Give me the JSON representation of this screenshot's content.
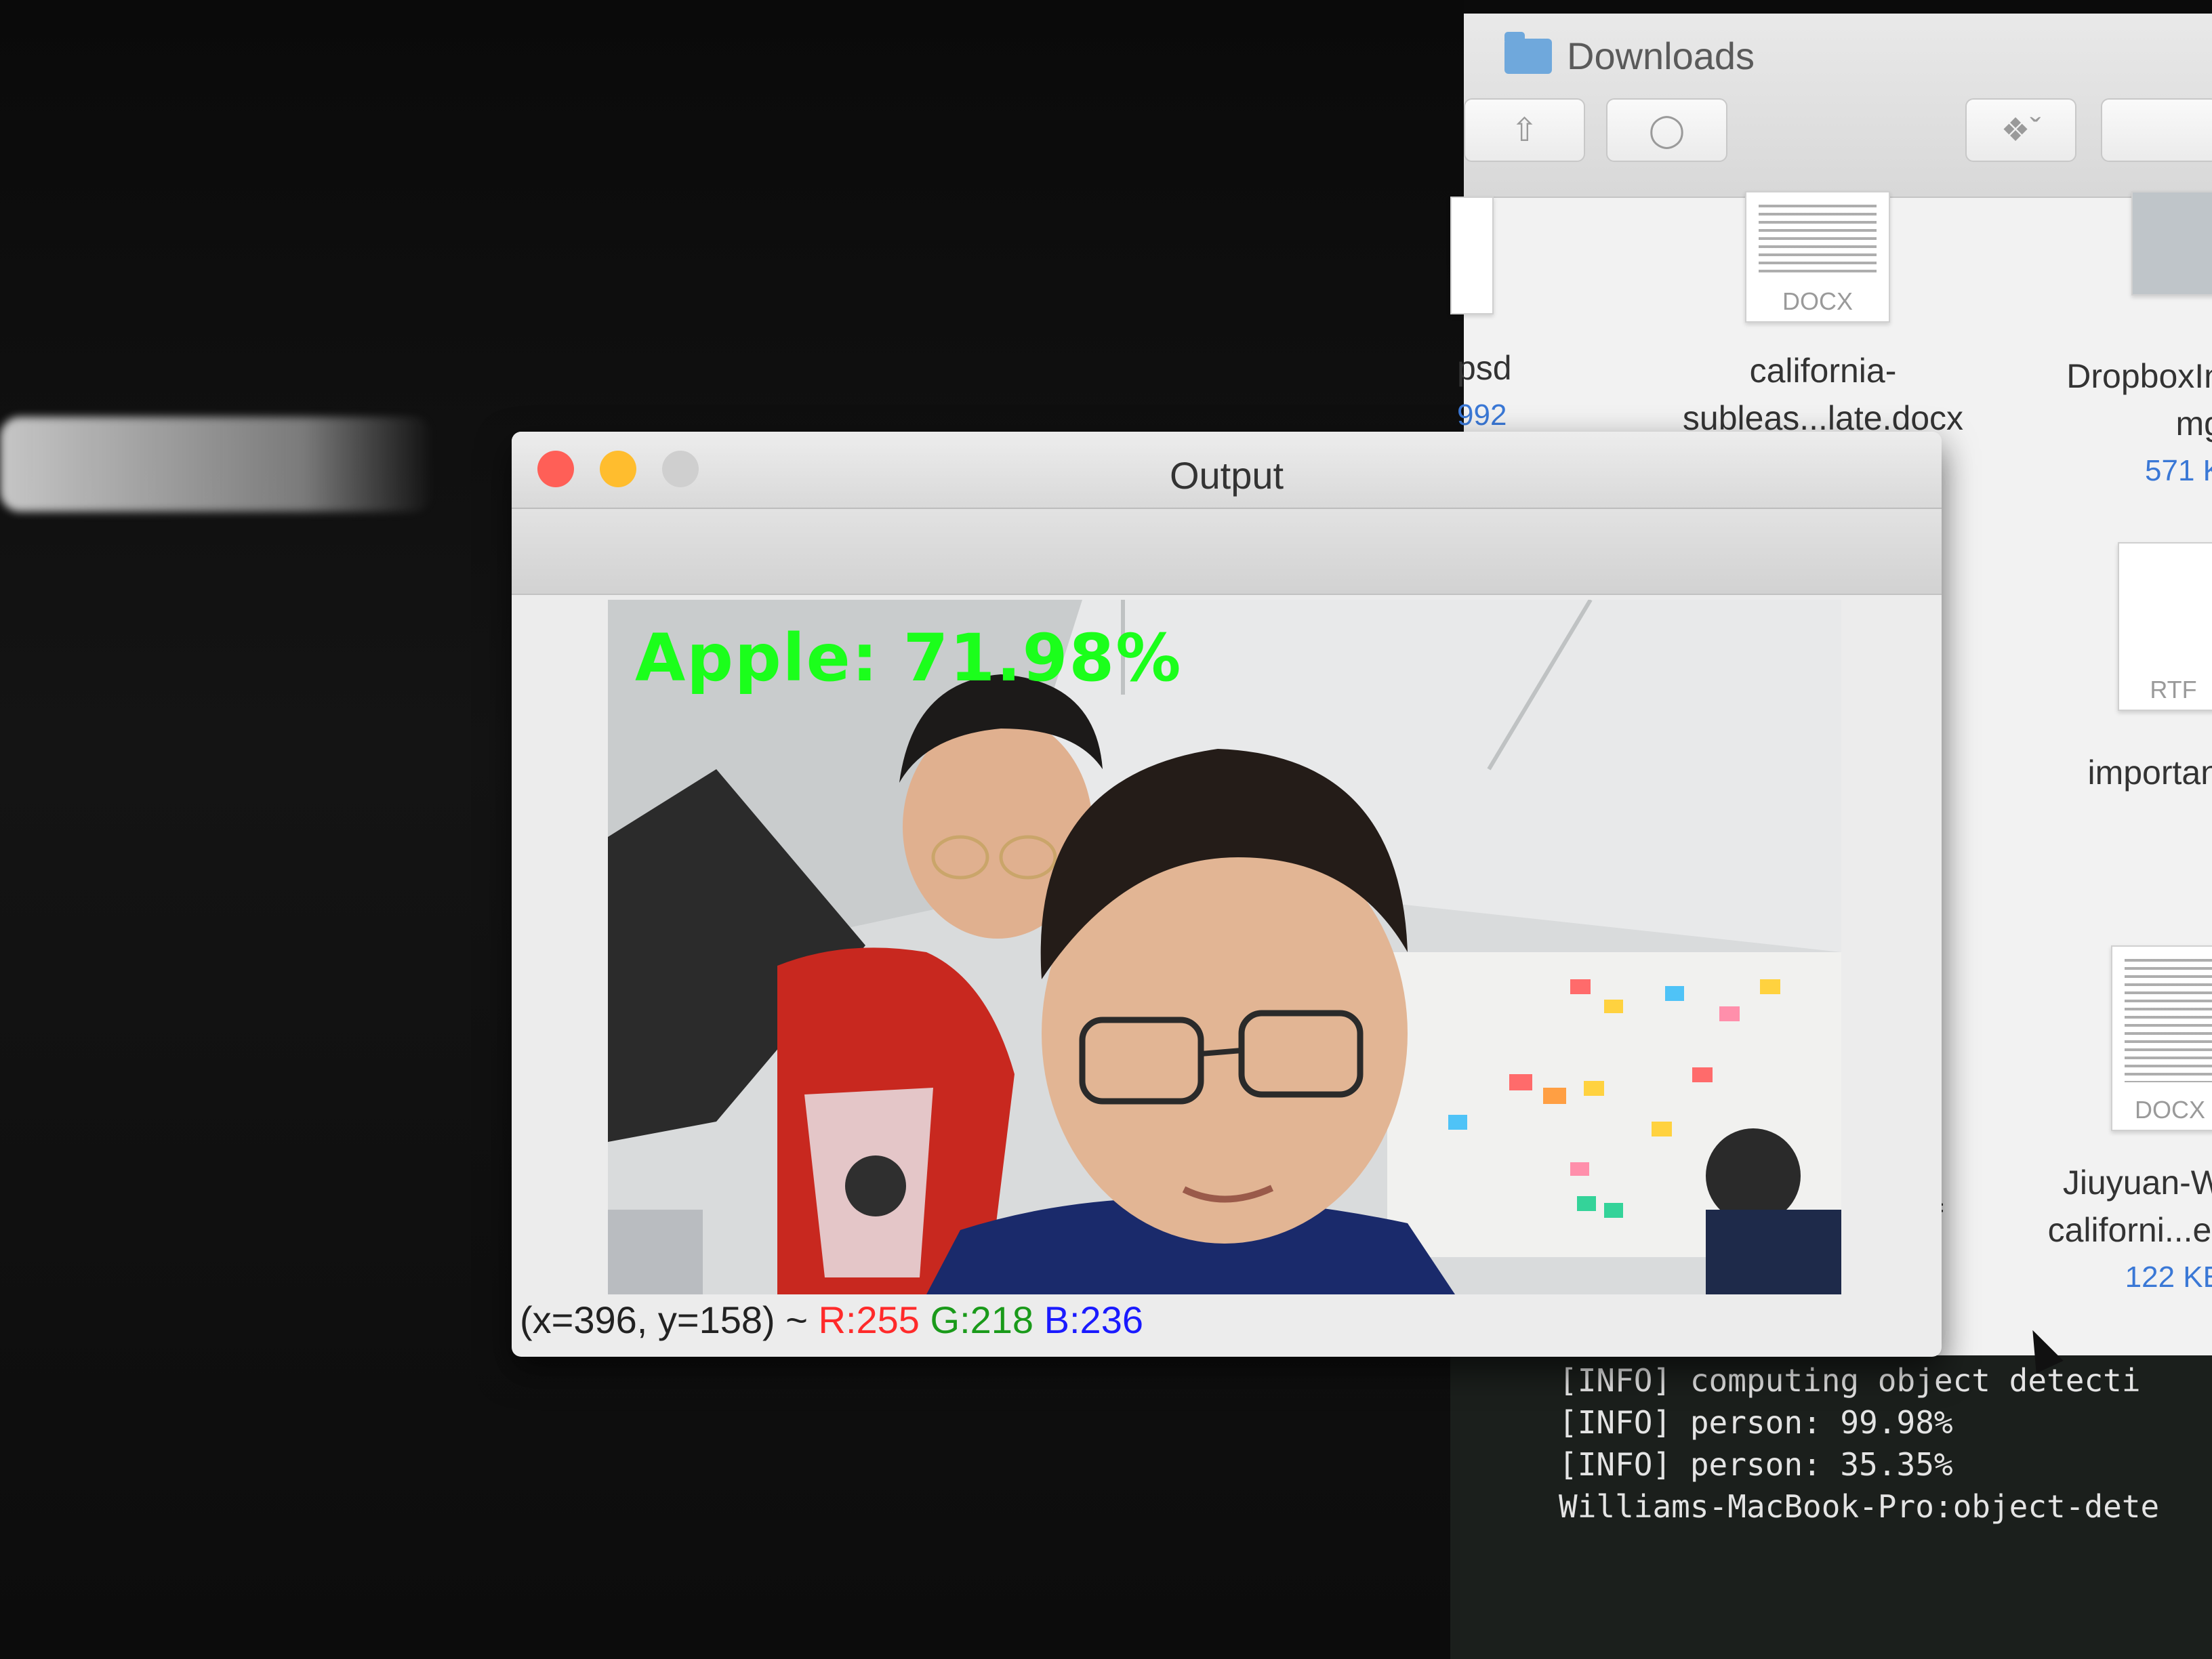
{
  "finder": {
    "title": "Downloads",
    "files": [
      {
        "name_lines": [
          "psd"
        ],
        "size": "992"
      },
      {
        "name_lines": [
          "california-",
          "subleas...late.docx"
        ],
        "ext": "DOCX"
      },
      {
        "name_lines": [
          "DropboxIn",
          "mg"
        ],
        "size": "571 K"
      },
      {
        "name_lines": [
          "importan"
        ],
        "ext": "RTF"
      },
      {
        "name_lines": [
          "f"
        ]
      },
      {
        "name_lines": [
          "Jiuyuan-W",
          "californi...e("
        ],
        "size": "122 KE",
        "ext": "DOCX"
      }
    ]
  },
  "output_window": {
    "title": "Output",
    "detection_label": "Apple: 71.98%",
    "status": {
      "coords": "(x=396, y=158) ~",
      "r": "R:255",
      "g": "G:218",
      "b": "B:236"
    }
  },
  "terminal": {
    "lines": [
      "[INFO] computing object detecti",
      "[INFO] person: 99.98%",
      "[INFO] person: 35.35%",
      "Williams-MacBook-Pro:object-dete"
    ]
  },
  "colors": {
    "close": "#ff5f57",
    "minimize": "#ffbd2e",
    "zoom_inactive": "#cfcfcf",
    "detect_text": "#1bff1b",
    "status_r": "#ff2a2a",
    "status_g": "#1a9a1a",
    "status_b": "#1a1aff"
  }
}
